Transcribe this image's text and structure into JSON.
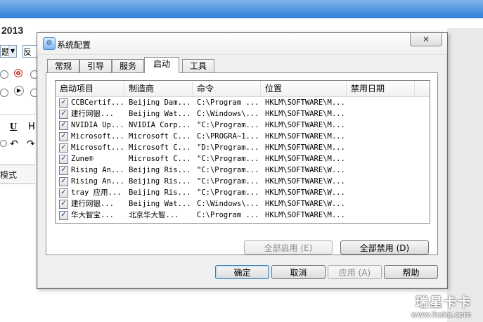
{
  "background": {
    "year_text": "2013",
    "select_value": "题",
    "feedback_label": "反馈",
    "toolbar_underline": "U",
    "toolbar_h": "H",
    "mode_text": "模式"
  },
  "dialog": {
    "title": "系统配置",
    "close_glyph": "✕",
    "tabs": [
      {
        "label": "常规"
      },
      {
        "label": "引导"
      },
      {
        "label": "服务"
      },
      {
        "label": "启动",
        "active": true
      },
      {
        "label": "工具"
      }
    ],
    "columns": [
      "启动项目",
      "制造商",
      "命令",
      "位置",
      "禁用日期"
    ],
    "rows": [
      {
        "checked": true,
        "item": "CCBCertif...",
        "maker": "Beijing Dam...",
        "command": "C:\\Program ...",
        "location": "HKLM\\SOFTWARE\\M...",
        "disabled_date": ""
      },
      {
        "checked": true,
        "item": "建行网银...",
        "maker": "Beijing Wat...",
        "command": "C:\\Windows\\...",
        "location": "HKLM\\SOFTWARE\\M...",
        "disabled_date": ""
      },
      {
        "checked": true,
        "item": "NVIDIA Up...",
        "maker": "NVIDIA Corp...",
        "command": "\"C:\\Program...",
        "location": "HKLM\\SOFTWARE\\M...",
        "disabled_date": ""
      },
      {
        "checked": true,
        "item": "Microsoft...",
        "maker": "Microsoft C...",
        "command": "C:\\PROGRA~1...",
        "location": "HKLM\\SOFTWARE\\M...",
        "disabled_date": ""
      },
      {
        "checked": true,
        "item": "Microsoft...",
        "maker": "Microsoft C...",
        "command": "\"D:\\Program...",
        "location": "HKLM\\SOFTWARE\\M...",
        "disabled_date": ""
      },
      {
        "checked": true,
        "item": "Zune®",
        "maker": "Microsoft C...",
        "command": "\"C:\\Program...",
        "location": "HKLM\\SOFTWARE\\M...",
        "disabled_date": ""
      },
      {
        "checked": true,
        "item": "Rising An...",
        "maker": "Beijing Ris...",
        "command": "\"C:\\Program...",
        "location": "HKLM\\SOFTWARE\\W...",
        "disabled_date": ""
      },
      {
        "checked": true,
        "item": "Rising An...",
        "maker": "Beijing Ris...",
        "command": "\"C:\\Program...",
        "location": "HKLM\\SOFTWARE\\W...",
        "disabled_date": ""
      },
      {
        "checked": true,
        "item": "tray 应用...",
        "maker": "Beijing Ris...",
        "command": "\"C:\\Program...",
        "location": "HKLM\\SOFTWARE\\W...",
        "disabled_date": ""
      },
      {
        "checked": true,
        "item": "建行网银...",
        "maker": "Beijing Wat...",
        "command": "C:\\Windows\\...",
        "location": "HKLM\\SOFTWARE\\W...",
        "disabled_date": ""
      },
      {
        "checked": true,
        "item": "华大智宝...",
        "maker": "北京华大智...",
        "command": "C:\\Program ...",
        "location": "HKLM\\SOFTWARE\\M...",
        "disabled_date": ""
      }
    ],
    "buttons": {
      "enable_all": "全部启用 (E)",
      "disable_all": "全部禁用 (D)",
      "ok": "确定",
      "cancel": "取消",
      "apply": "应用 (A)",
      "help": "帮助"
    }
  },
  "watermark": {
    "brand": "瑞星卡卡",
    "url": "www.ikaka.com"
  }
}
